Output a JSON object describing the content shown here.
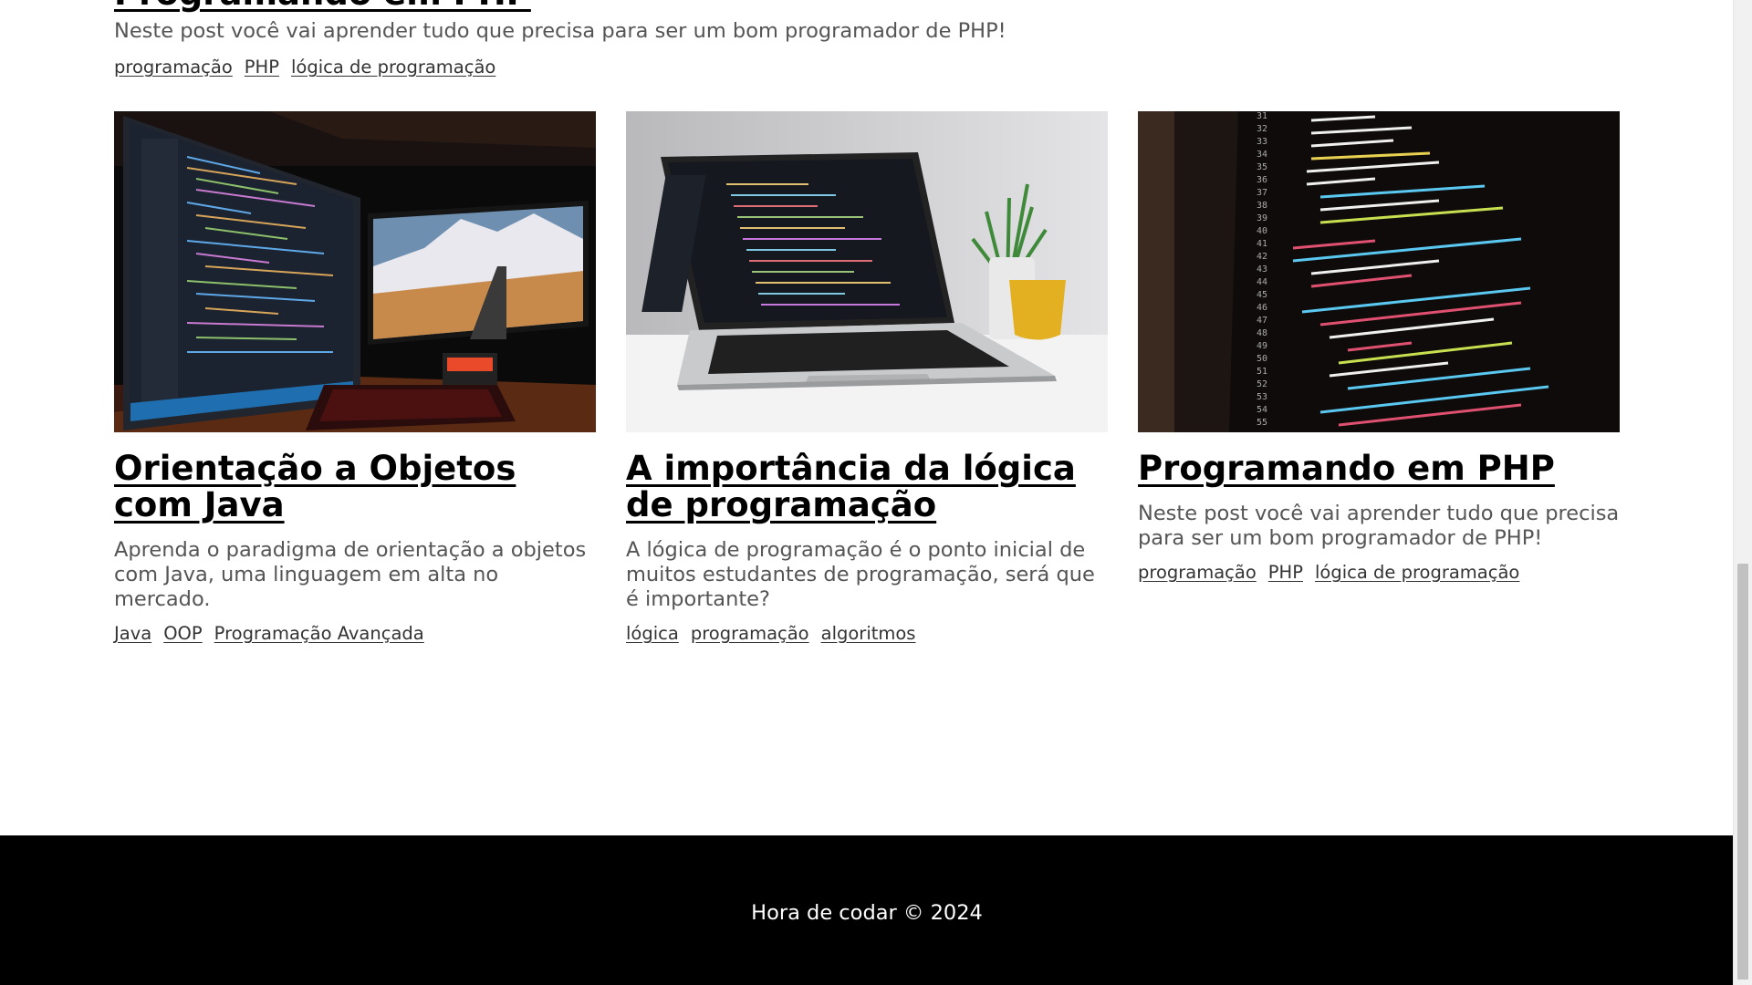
{
  "top_post": {
    "title": "Programando em PHP",
    "description": "Neste post você vai aprender tudo que precisa para ser um bom programador de PHP!",
    "tags": [
      "programação",
      "PHP",
      "lógica de programação"
    ]
  },
  "posts": [
    {
      "title": "Orientação a Objetos com Java",
      "description": "Aprenda o paradigma de orientação a objetos com Java, uma linguagem em alta no mercado.",
      "tags": [
        "Java",
        "OOP",
        "Programação Avançada"
      ]
    },
    {
      "title": "A importância da lógica de programação",
      "description": "A lógica de programação é o ponto inicial de muitos estudantes de programação, será que é importante?",
      "tags": [
        "lógica",
        "programação",
        "algoritmos"
      ]
    },
    {
      "title": "Programando em PHP",
      "description": "Neste post você vai aprender tudo que precisa para ser um bom programador de PHP!",
      "tags": [
        "programação",
        "PHP",
        "lógica de programação"
      ]
    }
  ],
  "footer": {
    "text": "Hora de codar © 2024"
  },
  "colors": {
    "title": "#000000",
    "description": "#555555",
    "tag": "#333333",
    "footer_bg": "#000000",
    "footer_text": "#ffffff"
  },
  "scrollbar": {
    "position_fraction": 0.93
  }
}
